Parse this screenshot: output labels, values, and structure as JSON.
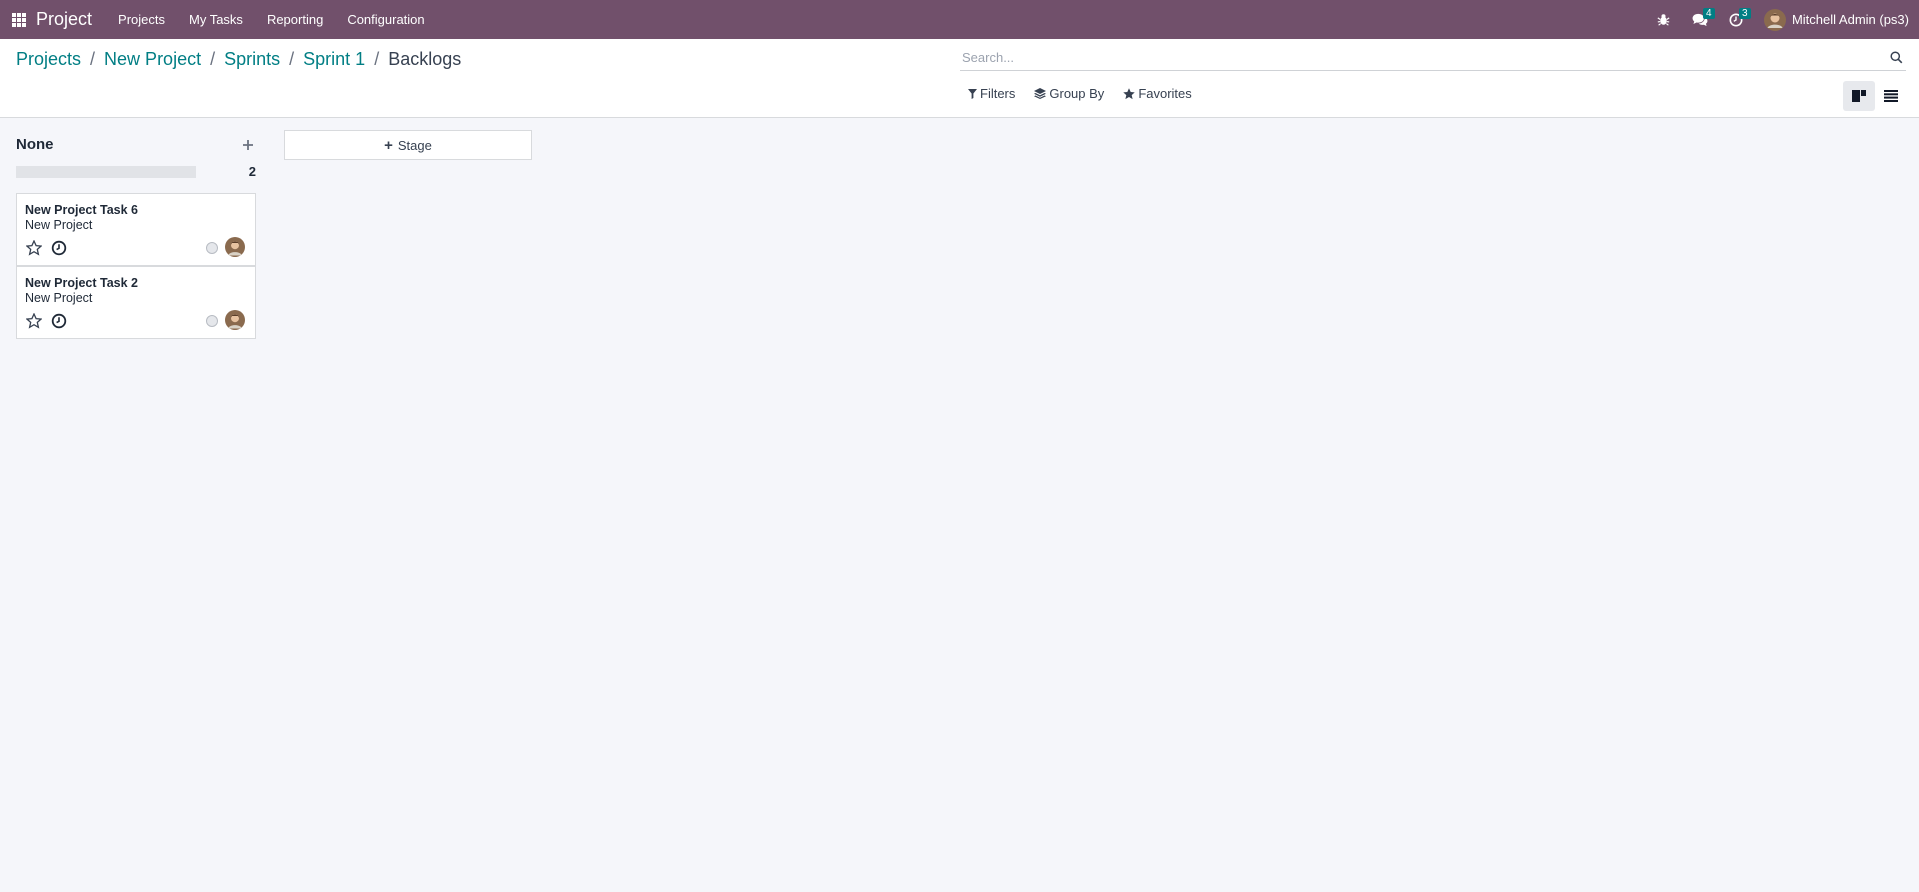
{
  "navbar": {
    "brand": "Project",
    "menu": [
      "Projects",
      "My Tasks",
      "Reporting",
      "Configuration"
    ],
    "messages_count": "4",
    "activities_count": "3",
    "user_name": "Mitchell Admin (ps3)"
  },
  "breadcrumb": {
    "items": [
      "Projects",
      "New Project",
      "Sprints",
      "Sprint 1"
    ],
    "current": "Backlogs"
  },
  "search": {
    "placeholder": "Search..."
  },
  "filters": {
    "filters_label": "Filters",
    "group_by_label": "Group By",
    "favorites_label": "Favorites"
  },
  "kanban": {
    "column": {
      "title": "None",
      "count": "2"
    },
    "cards": [
      {
        "title": "New Project Task 6",
        "project": "New Project"
      },
      {
        "title": "New Project Task 2",
        "project": "New Project"
      }
    ],
    "add_stage_label": "Stage"
  },
  "colors": {
    "navbar": "#71506b",
    "accent": "#017e84",
    "background": "#f5f6fa"
  }
}
